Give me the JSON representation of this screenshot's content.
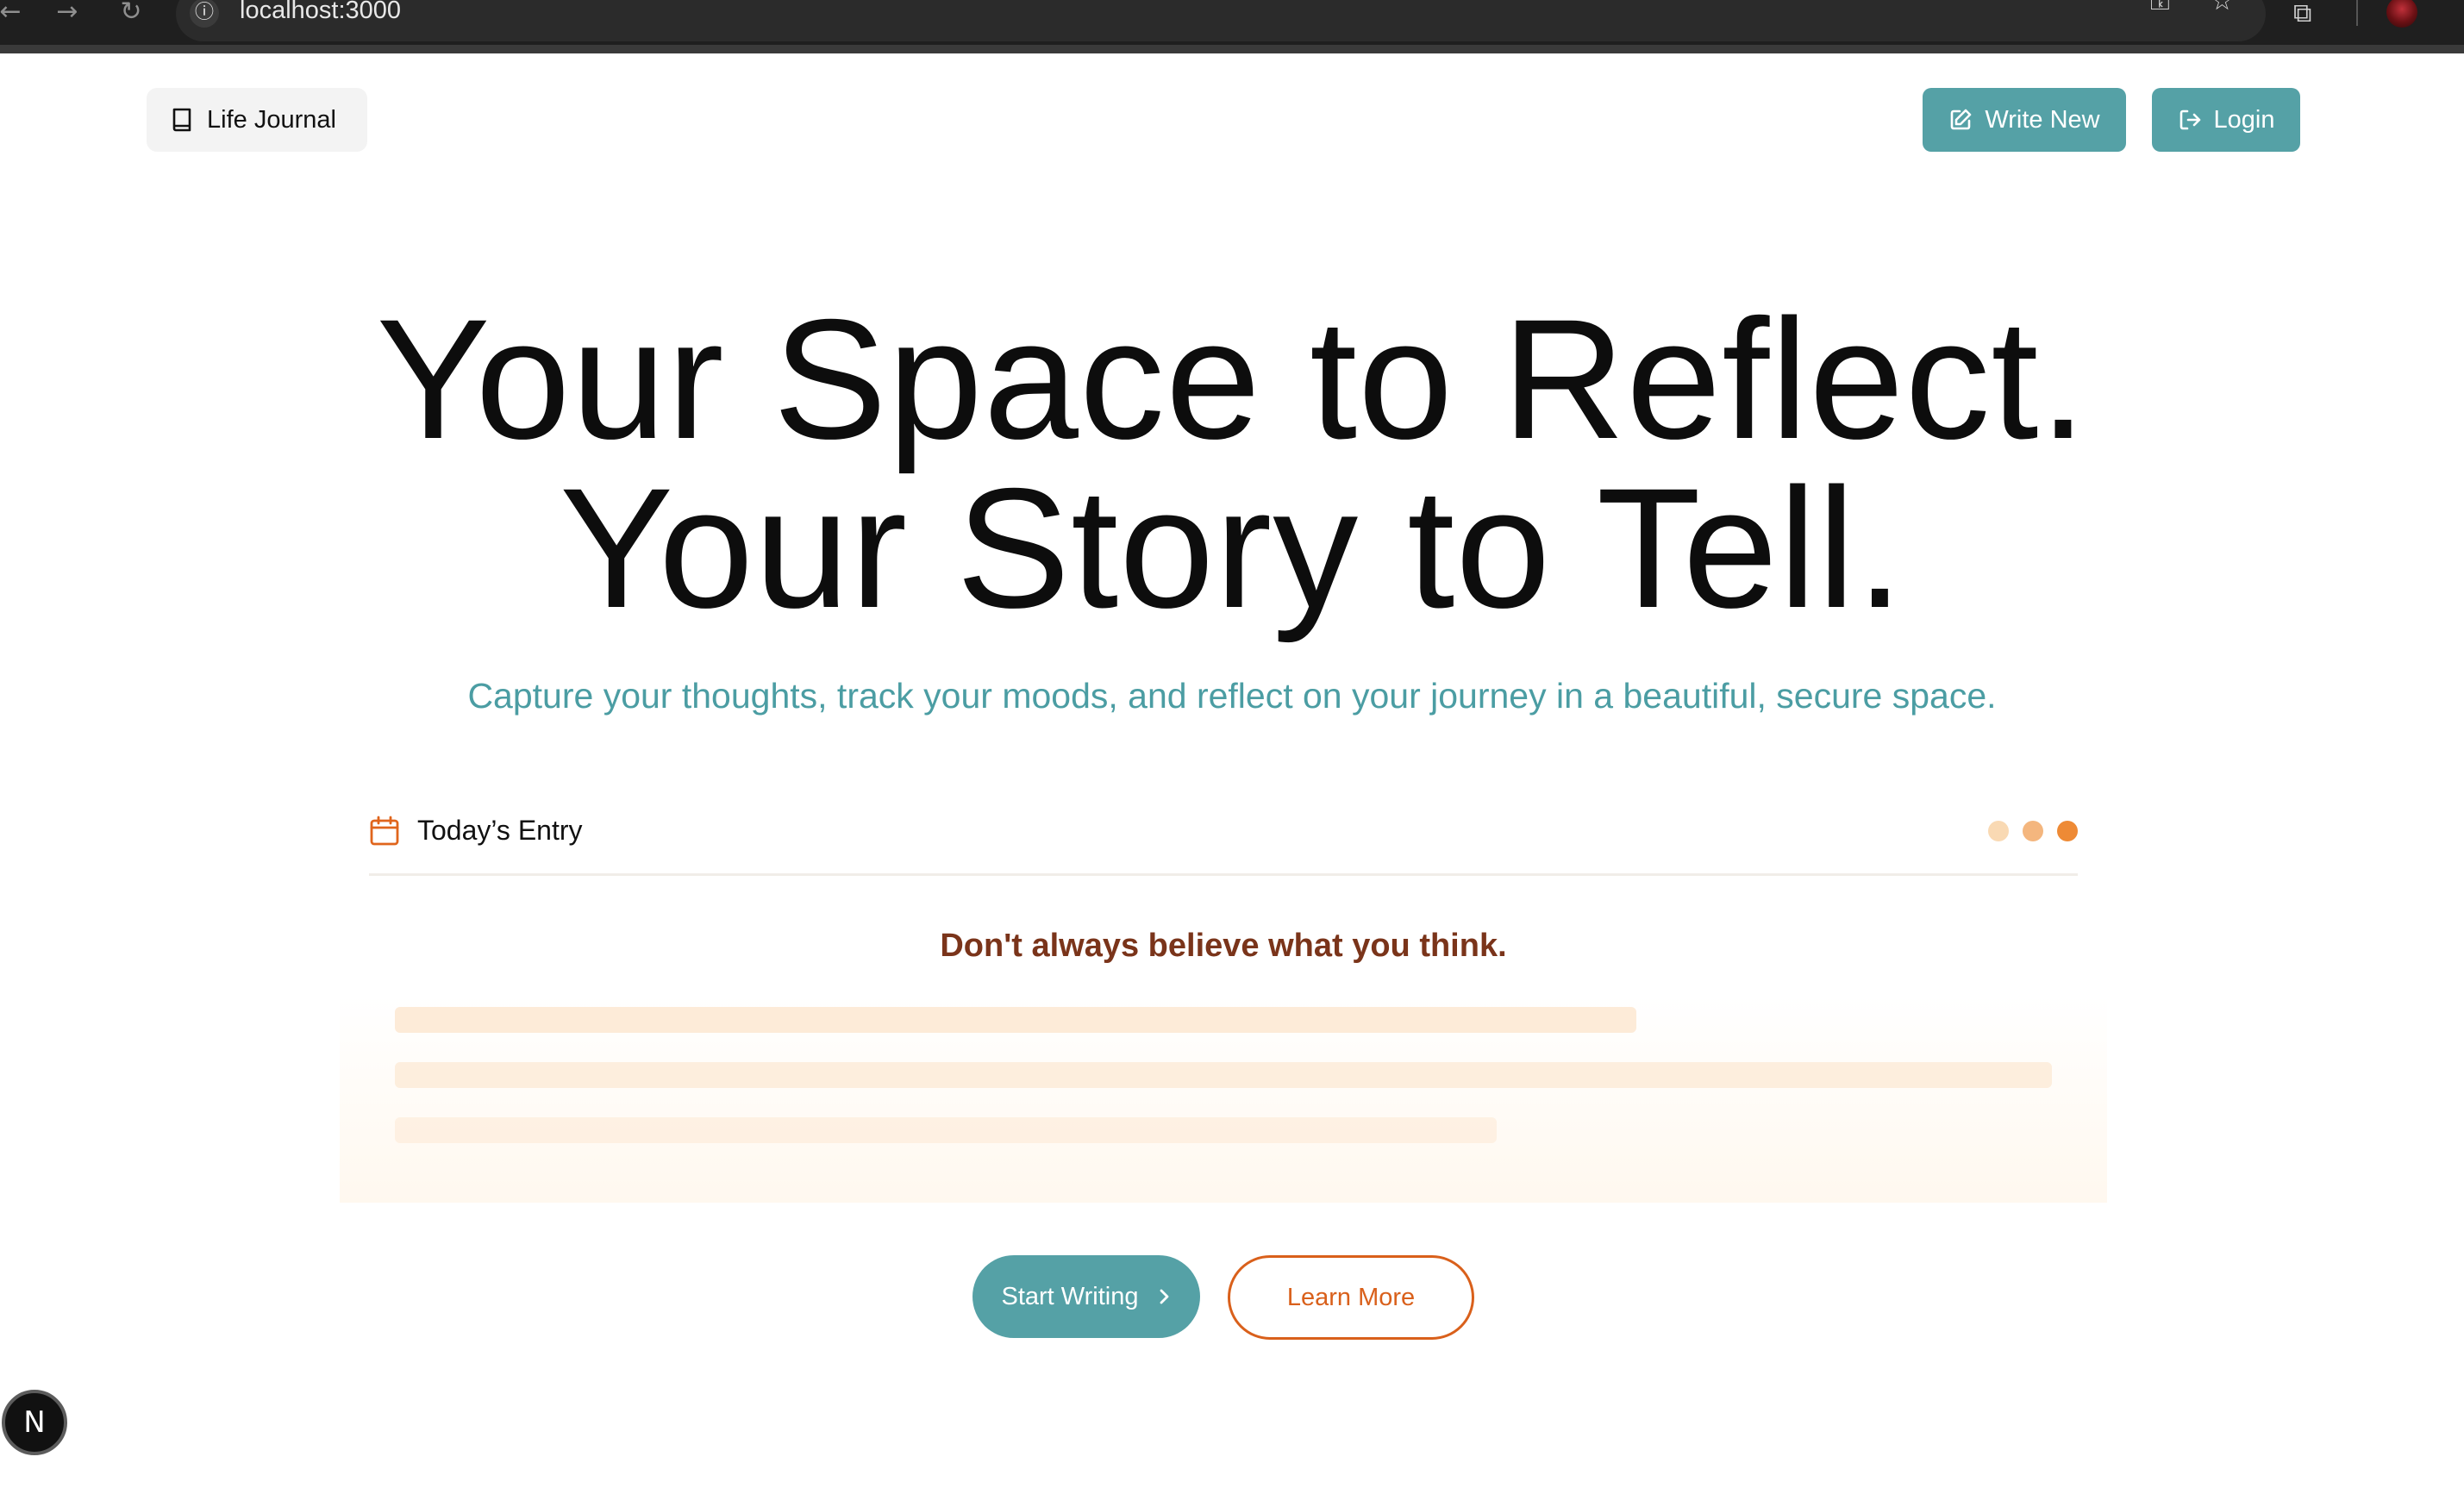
{
  "browser": {
    "url": "localhost:3000",
    "back_icon": "arrow-left-icon",
    "forward_icon": "arrow-right-icon",
    "reload_icon": "reload-icon",
    "info_icon": "info-icon",
    "key_icon": "key-icon",
    "star_icon": "star-icon",
    "extensions_icon": "puzzle-icon"
  },
  "header": {
    "brand_label": "Life Journal",
    "write_new_label": "Write New",
    "login_label": "Login"
  },
  "hero": {
    "title_line1": "Your Space to Reflect.",
    "title_line2": "Your Story to Tell.",
    "subtitle": "Capture your thoughts, track your moods, and reflect on your journey in a beautiful, secure space."
  },
  "entry_card": {
    "label": "Today’s Entry",
    "quote": "Don't always believe what you think.",
    "dot_colors": [
      "#f9d9b3",
      "#f4b67e",
      "#ee8a35"
    ]
  },
  "cta": {
    "start_label": "Start Writing",
    "learn_label": "Learn More"
  },
  "badge": {
    "letter": "N"
  },
  "colors": {
    "teal": "#55a1a6",
    "orange": "#d9601b",
    "quote_brown": "#7a341a",
    "placeholder_line": "#fdebd8"
  }
}
